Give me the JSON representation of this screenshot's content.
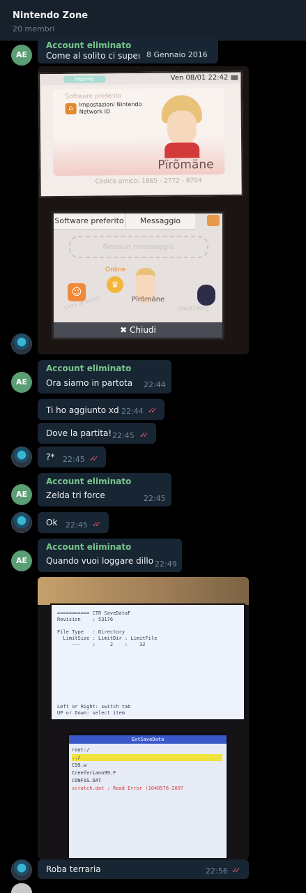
{
  "header": {
    "title": "Nintendo Zone",
    "members": "20 membri"
  },
  "date_pill": "8 Gennaio 2016",
  "messages": {
    "m1": {
      "sender": "Account eliminato",
      "text": "Come al solito ci supera",
      "avatar": "AE"
    },
    "m2": {
      "sender": "Account eliminato",
      "text": "Ora siamo in partota",
      "time": "22:44",
      "avatar": "AE"
    },
    "m3": {
      "text": "Ti ho aggiunto xd",
      "time": "22:44",
      "checks": "✓✓"
    },
    "m4": {
      "text": "Dove la partita!",
      "time": "22:45",
      "checks": "✓✓"
    },
    "m5": {
      "text": "?*",
      "time": "22:45",
      "checks": "✓✓"
    },
    "m6": {
      "sender": "Account eliminato",
      "text": "Zelda tri force",
      "time": "22:45",
      "avatar": "AE"
    },
    "m7": {
      "text": "Ok",
      "time": "22:45",
      "checks": "✓✓"
    },
    "m8": {
      "sender": "Account eliminato",
      "text": "Quando vuoi loggare dillo",
      "time": "22:49",
      "avatar": "AE"
    },
    "m9": {
      "text": "Roba terraria",
      "time": "22:56",
      "checks": "✓✓"
    }
  },
  "photo1": {
    "status_tag": "Internet",
    "clock": "Ven 08/01 22:42",
    "fav_label": "Software preferito",
    "fav_text": "Impostazioni Nintendo\nNetwork ID",
    "mii_name": "Pïrõmäne",
    "friend_code": "Codice amico: 1865 - 2772 - 8704",
    "tab_software": "Software preferito",
    "tab_message": "Messaggio",
    "no_message": "Nessun messaggio",
    "online": "Online",
    "player_name": "Pïrõmäne",
    "friend_list": "Lista di amici",
    "other": "[Wolf1996]",
    "close": "Chiudi"
  },
  "photo2": {
    "top_text": "=========== CTR SaveDataF\nRevision    : 53176\n\nFile Type   : Directory\n  LimitSize : LimitDir : LimitFile\n     ---    :     2    :    32\n",
    "top_footer": "Left or Right: switch tab\nUP or Down: select item",
    "bs_title": "ExtSaveData",
    "rows": [
      "root:/",
      "../",
      "C99.w",
      "Creeferiano99.F",
      "CONFIG.DAT",
      "scratch.dat : Read Error (1048576-2097"
    ]
  },
  "colors": {
    "accent_name": "#76c48a",
    "checks": "#e0556a",
    "bubble": "#182533",
    "header": "#17212b"
  }
}
